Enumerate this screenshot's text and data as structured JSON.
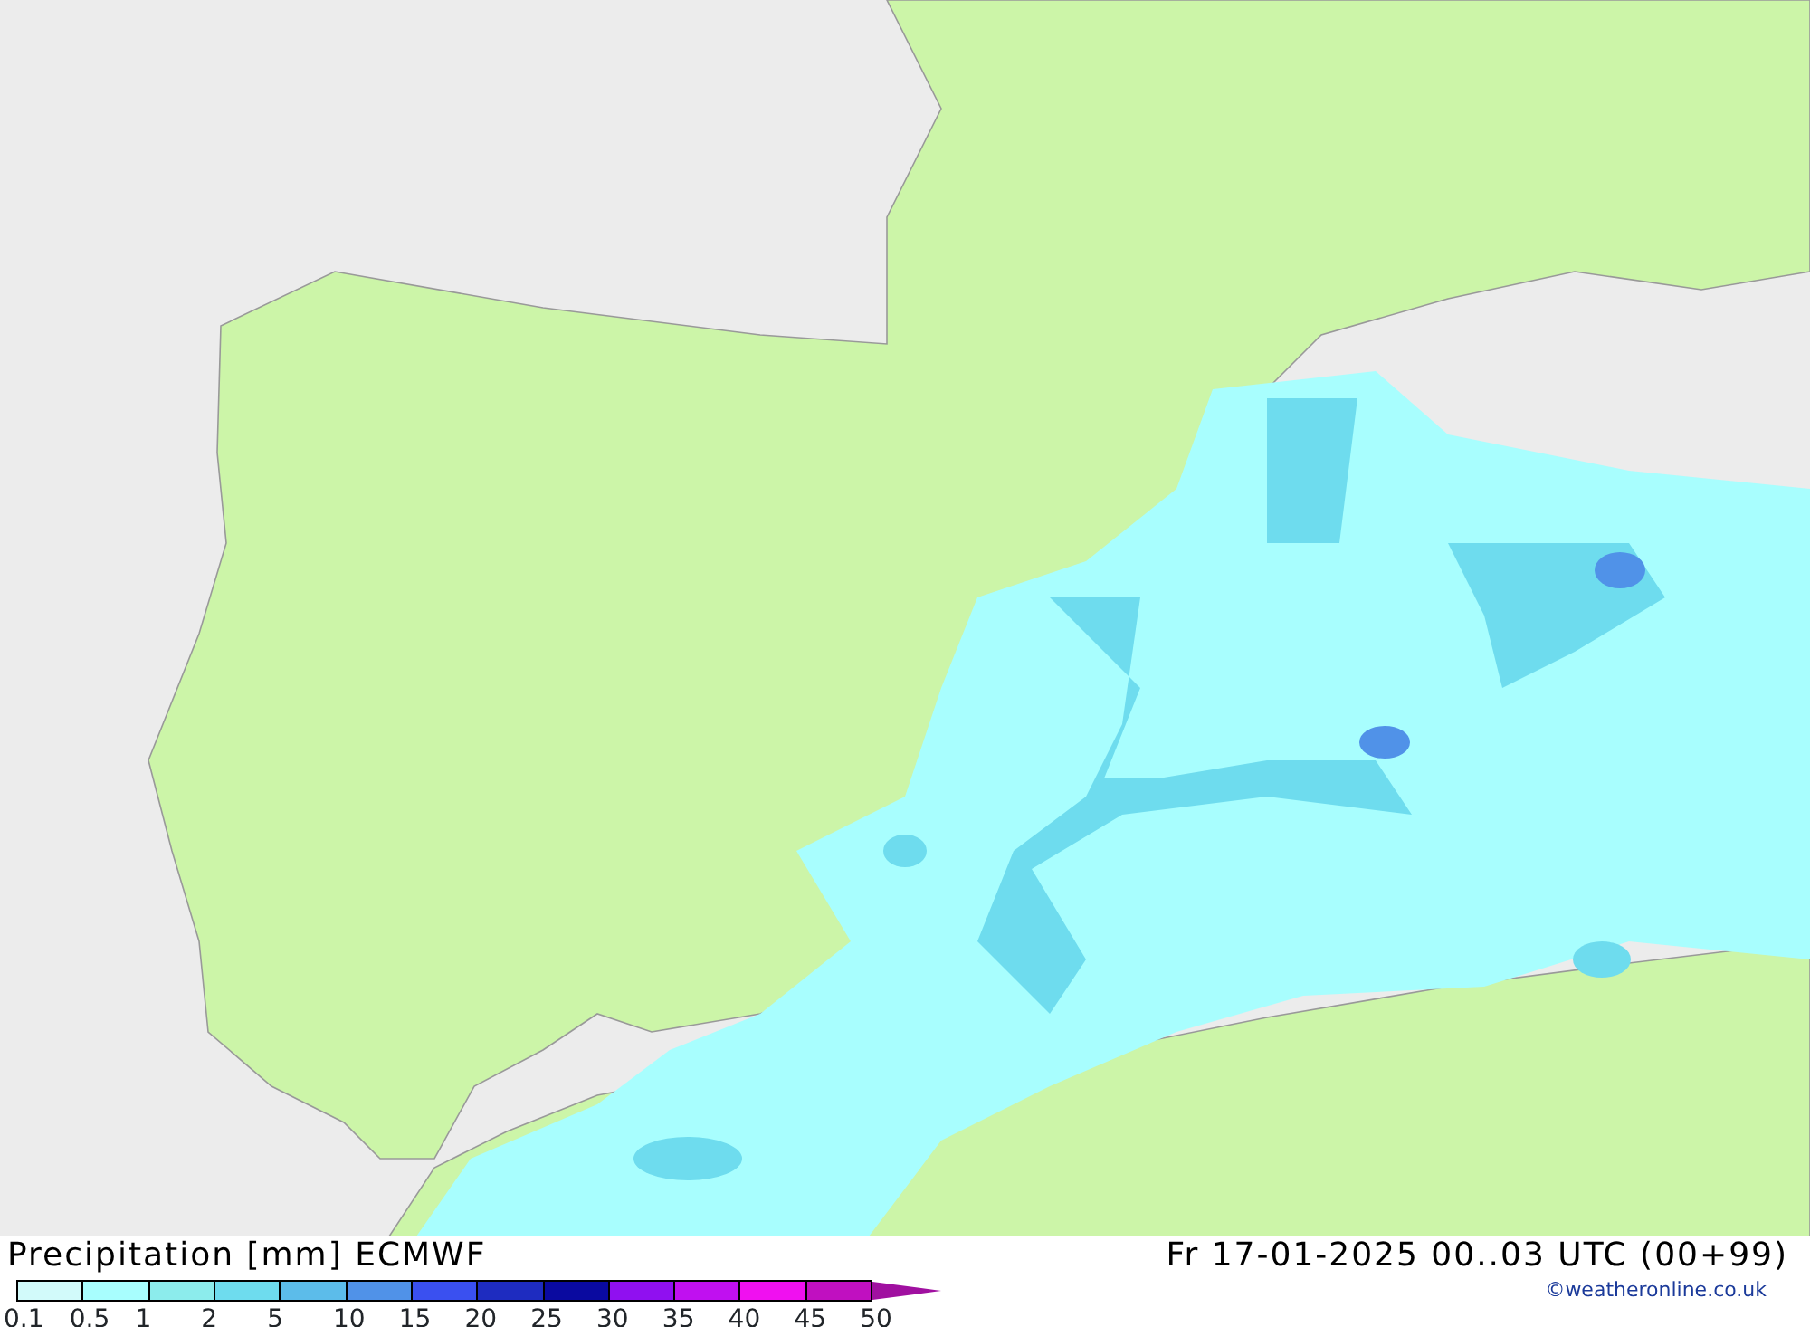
{
  "map": {
    "title": "Precipitation [mm]",
    "model": "ECMWF",
    "valid_time": "Fr 17-01-2025 00..03 UTC (00+99)"
  },
  "legend": {
    "steps": [
      {
        "color": "#d2fafa"
      },
      {
        "color": "#a8fefe"
      },
      {
        "color": "#8cecec"
      },
      {
        "color": "#6edcee"
      },
      {
        "color": "#5cbcea"
      },
      {
        "color": "#5092e8"
      },
      {
        "color": "#3a50f0"
      },
      {
        "color": "#1e2cc0"
      },
      {
        "color": "#0a0aa0"
      },
      {
        "color": "#9010f0"
      },
      {
        "color": "#c010f0"
      },
      {
        "color": "#f010f0"
      },
      {
        "color": "#c010c0"
      }
    ],
    "labels": [
      "0.1",
      "0.5",
      "1",
      "2",
      "5",
      "10",
      "15",
      "20",
      "25",
      "30",
      "35",
      "40",
      "45",
      "50"
    ]
  },
  "credit": "©weatheronline.co.uk"
}
